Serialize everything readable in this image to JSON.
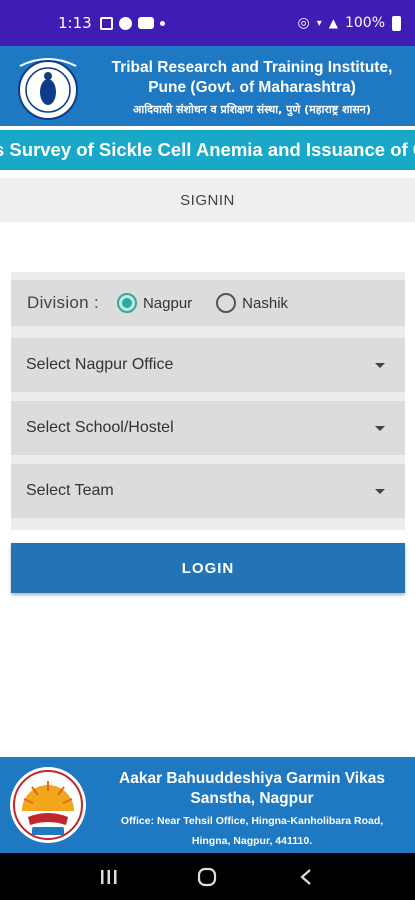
{
  "status_bar": {
    "time": "1:13",
    "battery": "100%"
  },
  "header": {
    "title_line1": "Tribal Research and Training Institute,",
    "title_line2": "Pune (Govt. of Maharashtra)",
    "subtitle": "आदिवासी संशोधन व प्रशिक्षण संस्था, पुणे (महाराष्ट्र शासन)",
    "logo_text": "TRTI"
  },
  "marquee": {
    "text": "s Survey of Sickle Cell Anemia and Issuance of Car"
  },
  "signin": {
    "label": "SIGNIN"
  },
  "form": {
    "division_label": "Division :",
    "division_options": [
      {
        "label": "Nagpur",
        "selected": true
      },
      {
        "label": "Nashik",
        "selected": false
      }
    ],
    "office_select": "Select Nagpur Office",
    "school_select": "Select School/Hostel",
    "team_select": "Select Team"
  },
  "login": {
    "label": "LOGIN"
  },
  "footer": {
    "title_line1": "Aakar Bahuuddeshiya Garmin Vikas",
    "title_line2": "Sanstha, Nagpur",
    "address_line1": "Office: Near Tehsil Office, Hingna-Kanholibara Road,",
    "address_line2": "Hingna, Nagpur, 441110."
  },
  "colors": {
    "status_bar": "#3f1cb3",
    "header": "#1e78c2",
    "marquee": "#1aa8c9",
    "accent_radio": "#19b3a0",
    "login_button": "#2274b7"
  }
}
